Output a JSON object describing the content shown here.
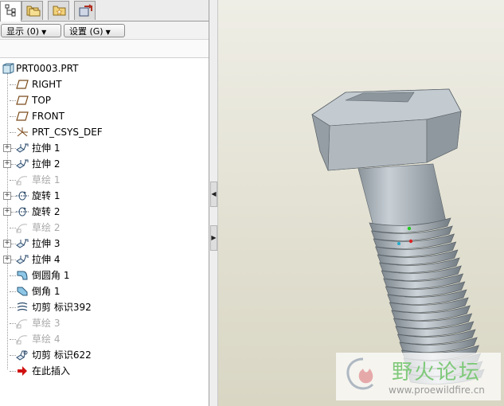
{
  "toolbar": {
    "show_label": "显示 (0)",
    "settings_label": "设置 (G)"
  },
  "tabs": [
    {
      "icon": "model-tree-icon",
      "active": true
    },
    {
      "icon": "folder-browser-icon",
      "active": false
    },
    {
      "icon": "favorites-icon",
      "active": false
    },
    {
      "icon": "connections-icon",
      "active": false
    }
  ],
  "tree": {
    "root": "PRT0003.PRT",
    "items": [
      {
        "label": "RIGHT",
        "icon": "datum-plane-icon",
        "expandable": false,
        "dim": false
      },
      {
        "label": "TOP",
        "icon": "datum-plane-icon",
        "expandable": false,
        "dim": false
      },
      {
        "label": "FRONT",
        "icon": "datum-plane-icon",
        "expandable": false,
        "dim": false
      },
      {
        "label": "PRT_CSYS_DEF",
        "icon": "csys-icon",
        "expandable": false,
        "dim": false
      },
      {
        "label": "拉伸 1",
        "icon": "extrude-icon",
        "expandable": true,
        "dim": false
      },
      {
        "label": "拉伸 2",
        "icon": "extrude-icon",
        "expandable": true,
        "dim": false
      },
      {
        "label": "草绘 1",
        "icon": "sketch-icon",
        "expandable": false,
        "dim": true
      },
      {
        "label": "旋转 1",
        "icon": "revolve-icon",
        "expandable": true,
        "dim": false
      },
      {
        "label": "旋转 2",
        "icon": "revolve-icon",
        "expandable": true,
        "dim": false
      },
      {
        "label": "草绘 2",
        "icon": "sketch-icon",
        "expandable": false,
        "dim": true
      },
      {
        "label": "拉伸 3",
        "icon": "extrude-icon",
        "expandable": true,
        "dim": false
      },
      {
        "label": "拉伸 4",
        "icon": "extrude-icon",
        "expandable": true,
        "dim": false
      },
      {
        "label": "倒圆角 1",
        "icon": "round-icon",
        "expandable": false,
        "dim": false
      },
      {
        "label": "倒角 1",
        "icon": "chamfer-icon",
        "expandable": false,
        "dim": false
      },
      {
        "label": "切剪 标识392",
        "icon": "helical-cut-icon",
        "expandable": false,
        "dim": false
      },
      {
        "label": "草绘 3",
        "icon": "sketch-icon",
        "expandable": false,
        "dim": true
      },
      {
        "label": "草绘 4",
        "icon": "sketch-icon",
        "expandable": false,
        "dim": true
      },
      {
        "label": "切剪 标识622",
        "icon": "cut-icon",
        "expandable": false,
        "dim": false
      },
      {
        "label": "在此插入",
        "icon": "insert-here-arrow-icon",
        "expandable": false,
        "dim": false
      }
    ]
  },
  "watermark": {
    "text": "野火论坛",
    "url": "www.proewildfire.cn"
  },
  "colors": {
    "viewport_bg": "#e6e4d6",
    "bolt": "#a9b2b9",
    "insert_arrow": "#d01010"
  }
}
